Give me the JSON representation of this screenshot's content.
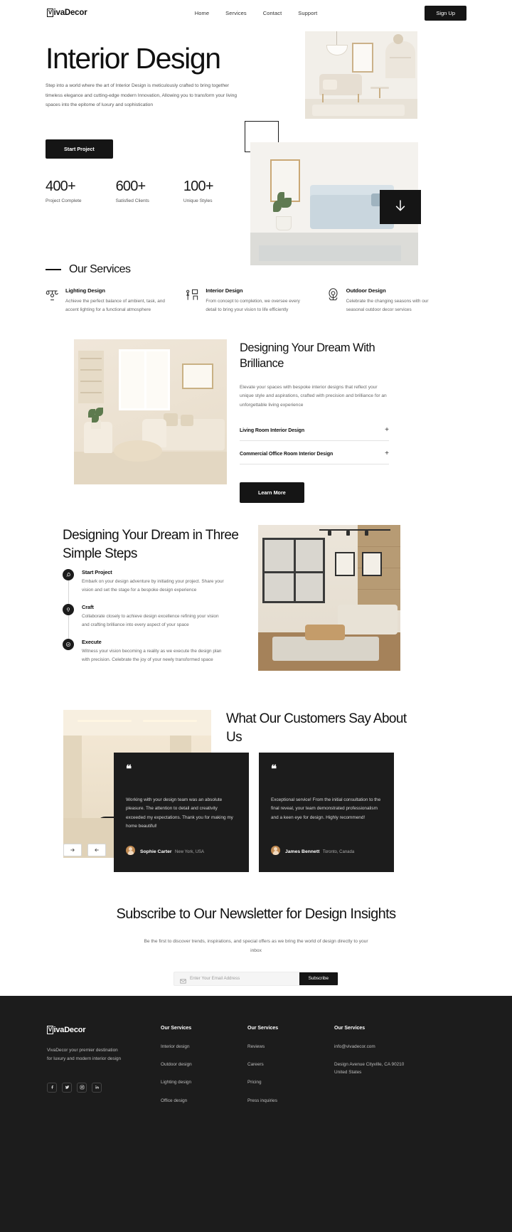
{
  "header": {
    "logo": "VivaDecor",
    "logo_initial": "V",
    "nav": [
      {
        "label": "Home"
      },
      {
        "label": "Services"
      },
      {
        "label": "Contact"
      },
      {
        "label": "Support"
      }
    ],
    "signup_label": "Sign Up"
  },
  "hero": {
    "title": "Interior Design",
    "subtitle": "Step into a world where the art of Interior Design is meticulously crafted to bring together timeless elegance and cutting-edge modern Innovation, Allowing you to transform your living spaces into the epitome of luxury and sophistication",
    "cta_label": "Start Project",
    "scroll_icon": "arrow-down-icon",
    "stats": [
      {
        "value": "400+",
        "label": "Project Complete"
      },
      {
        "value": "600+",
        "label": "Satisfied Clients"
      },
      {
        "value": "100+",
        "label": "Unique Styles"
      }
    ]
  },
  "services": {
    "heading": "Our Services",
    "items": [
      {
        "icon": "lighting-icon",
        "title": "Lighting Design",
        "desc": "Achieve the perfect balance of ambient, task, and accent lighting for a functional atmosphere"
      },
      {
        "icon": "interior-icon",
        "title": "Interior Design",
        "desc": "From concept to completion, we oversee every detail to bring your vision to life efficiently"
      },
      {
        "icon": "outdoor-icon",
        "title": "Outdoor Design",
        "desc": "Celebrate the changing seasons with our seasonal outdoor decor services"
      }
    ]
  },
  "brilliance": {
    "title": "Designing Your Dream With Brilliance",
    "desc": "Elevate your spaces with bespoke interior designs that reflect your unique style and aspirations, crafted with precision and brilliance for an unforgettable living experience",
    "accordion": [
      {
        "label": "Living Room Interior Design",
        "toggle": "+"
      },
      {
        "label": "Commercial Office Room Interior Design",
        "toggle": "+"
      }
    ],
    "cta_label": "Learn More"
  },
  "steps": {
    "title": "Designing Your Dream in Three Simple Steps",
    "items": [
      {
        "icon": "rocket-icon",
        "title": "Start Project",
        "desc": "Embark on your design adventure by initiating your project. Share your vision and set the stage for a bespoke design experience"
      },
      {
        "icon": "lightbulb-icon",
        "title": "Craft",
        "desc": "Collaborate closely to achieve design excellence refining your vision and crafting brilliance into every aspect of your space"
      },
      {
        "icon": "check-circle-icon",
        "title": "Execute",
        "desc": "Witness your vision becoming a reality as we execute the design plan with precision. Celebrate the joy of your newly transformed space"
      }
    ]
  },
  "testimonials": {
    "title": "What Our Customers Say About Us",
    "quote_mark": "❝",
    "cards": [
      {
        "text": "Working with your design team was an absolute pleasure. The attention to detail and creativity exceeded my expectations. Thank you for making my home beautiful!",
        "name": "Sophie Carter",
        "location": "New York, USA"
      },
      {
        "text": "Exceptional service! From the initial consultation to the final reveal, your team demonstrated professionalism and a keen eye for design. Highly recommend!",
        "name": "James Bennett",
        "location": "Toronto, Canada"
      }
    ],
    "next_icon": "arrow-right-icon",
    "prev_icon": "arrow-left-icon"
  },
  "newsletter": {
    "title": "Subscribe to Our Newsletter for Design Insights",
    "desc": "Be the first to discover trends, inspirations, and special offers as we bring the world of design directly to your inbox",
    "placeholder": "Enter Your Email Address",
    "value": "",
    "button_label": "Subscribe",
    "mail_icon": "mail-icon"
  },
  "footer": {
    "logo": "VivaDecor",
    "logo_initial": "V",
    "about": "VivaDecor your premier destination for luxury and modern interior design",
    "social": [
      {
        "name": "facebook-icon",
        "glyph": "f"
      },
      {
        "name": "twitter-icon",
        "glyph": "t"
      },
      {
        "name": "instagram-icon",
        "glyph": "i"
      },
      {
        "name": "linkedin-icon",
        "glyph": "in"
      }
    ],
    "columns": [
      {
        "title": "Our Services",
        "links": [
          {
            "label": "Interior design"
          },
          {
            "label": "Outdoor design"
          },
          {
            "label": "Lighting design"
          },
          {
            "label": "Office design"
          }
        ]
      },
      {
        "title": "Our Services",
        "links": [
          {
            "label": "Reviews"
          },
          {
            "label": "Careers"
          },
          {
            "label": "Pricing"
          },
          {
            "label": "Press inquiries"
          }
        ]
      },
      {
        "title": "Our Services",
        "links": [
          {
            "label": "info@vivadecor.com"
          },
          {
            "label": "Design Avenue Cityville, CA 90210 United States"
          }
        ]
      }
    ]
  },
  "colors": {
    "accent_dark": "#1c1c1c",
    "page_bg": "#ffffff",
    "muted_text": "#666666"
  }
}
